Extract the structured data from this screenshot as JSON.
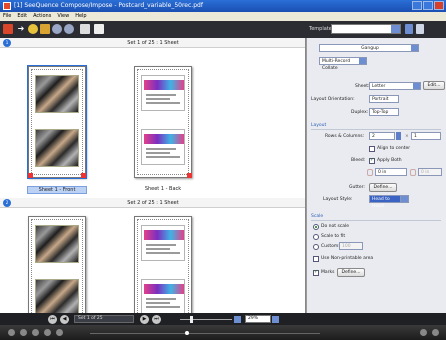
{
  "window": {
    "title": "[1] SeeQuence Compose/Impose - Postcard_variable_50rec.pdf"
  },
  "menu": [
    "File",
    "Edit",
    "Actions",
    "View",
    "Help"
  ],
  "toolbar": {
    "template_label": "Template:",
    "template_value": ""
  },
  "preview": {
    "sets": [
      {
        "header": "Set 1 of 25 : 1 Sheet",
        "sheets": [
          {
            "label": "Sheet 1 - Front",
            "selected": true
          },
          {
            "label": "Sheet 1 - Back",
            "selected": false
          }
        ]
      },
      {
        "header": "Set 2 of 25 : 1 Sheet",
        "sheets": [
          {
            "label": "",
            "selected": false
          },
          {
            "label": "",
            "selected": false
          }
        ]
      }
    ]
  },
  "panel": {
    "mode_top": "Gangup",
    "mode_sub": "Multi-Record Collate",
    "sheet_label": "Sheet:",
    "sheet_value": "Letter",
    "edit_button": "Edit...",
    "orientation_label": "Layout Orientation:",
    "orientation_value": "Portrait",
    "duplex_label": "Duplex:",
    "duplex_value": "Top-Top",
    "layout_section": "Layout",
    "rows_cols_label": "Rows & Columns:",
    "rows_value": "2",
    "cols_value": "1",
    "align_center_label": "Align to center",
    "bleed_label": "Bleed:",
    "apply_both_label": "Apply Both",
    "bleed_value_1": "0 in",
    "bleed_value_2": "0 in",
    "gutter_label": "Gutter:",
    "gutter_button": "Define...",
    "layout_style_label": "Layout Style:",
    "layout_style_value": "Head to Head",
    "scale_section": "Scale",
    "scale_options": [
      "Do not scale",
      "Scale to fit",
      "Custom:"
    ],
    "custom_value": "100",
    "nonprint_label": "Use Non-printable area",
    "marks_label": "Marks",
    "marks_button": "Define..."
  },
  "navbar": {
    "set_select": "Set 1 of 25",
    "zoom": "29%"
  }
}
